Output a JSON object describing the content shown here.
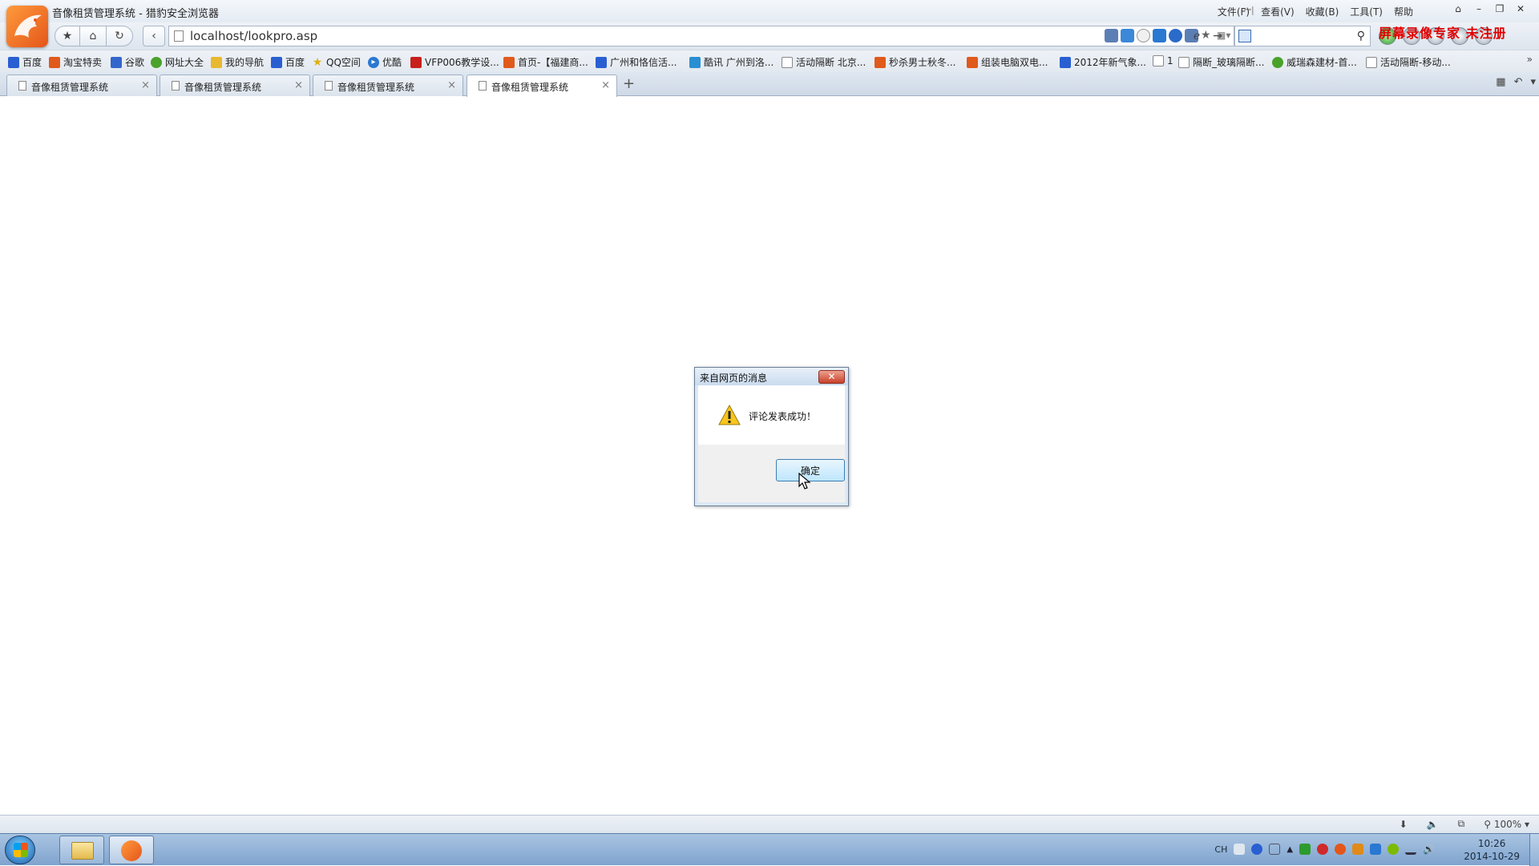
{
  "window": {
    "title": "音像租赁管理系统 - 猎豹安全浏览器",
    "menus": [
      "文件(F)",
      "查看(V)",
      "收藏(B)",
      "工具(T)",
      "帮助"
    ],
    "watermark": "屏幕录像专家 未注册"
  },
  "navbar": {
    "address": "localhost/lookpro.asp",
    "search_placeholder": ""
  },
  "bookmarks": [
    {
      "label": "百度",
      "icon": "paw-icon",
      "color": "#2a5fd2"
    },
    {
      "label": "淘宝特卖",
      "icon": "zhi-icon",
      "color": "#e05a1c"
    },
    {
      "label": "谷歌",
      "icon": "g-icon",
      "color": "#3366cc"
    },
    {
      "label": "网址大全",
      "icon": "globe-icon",
      "color": "#4aa22a"
    },
    {
      "label": "我的导航",
      "icon": "folder-icon",
      "color": "#e8b830"
    },
    {
      "label": "百度",
      "icon": "paw-icon",
      "color": "#2a5fd2"
    },
    {
      "label": "QQ空间",
      "icon": "star-icon",
      "color": "#f0c020"
    },
    {
      "label": "优酷",
      "icon": "play-icon",
      "color": "#2a78d2"
    },
    {
      "label": "VFP006教学设...",
      "icon": "zhi-icon",
      "color": "#c8201c"
    },
    {
      "label": "首页-【福建商...",
      "icon": "zhi-icon",
      "color": "#e05a1c"
    },
    {
      "label": "广州和恪信活...",
      "icon": "paw-icon",
      "color": "#2a5fd2"
    },
    {
      "label": "酷讯 广州到洛...",
      "icon": "flag-icon",
      "color": "#2a8fd2"
    },
    {
      "label": "活动隔断 北京...",
      "icon": "page-icon",
      "color": "#ffffff"
    },
    {
      "label": "秒杀男士秋冬...",
      "icon": "zhi-icon",
      "color": "#e05a1c"
    },
    {
      "label": "组装电脑双电...",
      "icon": "zhi-icon",
      "color": "#e05a1c"
    },
    {
      "label": "2012年新气象...",
      "icon": "paw-icon",
      "color": "#2a5fd2"
    },
    {
      "label": "1",
      "icon": "page-icon",
      "color": "#ffffff"
    },
    {
      "label": "隔断_玻璃隔断...",
      "icon": "page-icon",
      "color": "#ffffff"
    },
    {
      "label": "威瑞森建材-首...",
      "icon": "leaf-icon",
      "color": "#4aa22a"
    },
    {
      "label": "活动隔断-移动...",
      "icon": "page-icon",
      "color": "#ffffff"
    }
  ],
  "tabs": [
    {
      "label": "音像租赁管理系统",
      "active": false
    },
    {
      "label": "音像租赁管理系统",
      "active": false
    },
    {
      "label": "音像租赁管理系统",
      "active": false
    },
    {
      "label": "音像租赁管理系统",
      "active": true
    }
  ],
  "dialog": {
    "title": "来自网页的消息",
    "message": "评论发表成功！",
    "ok_label": "确定"
  },
  "statusbar": {
    "zoom": "100%"
  },
  "taskbar": {
    "tray_lang": "CH",
    "time": "10:26",
    "date": "2014-10-29"
  }
}
